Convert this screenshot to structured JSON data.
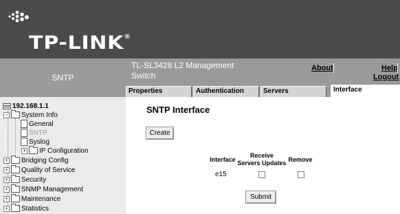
{
  "brand": {
    "logo_text": "TP-LINK",
    "registered": "®"
  },
  "section": {
    "title": "SNTP"
  },
  "device": {
    "title": "TL-SL3428 L2 Management Switch"
  },
  "header_links": {
    "about": "About",
    "help": "Help",
    "logout": "Logout"
  },
  "tabs": [
    {
      "label": "Properties",
      "active": false
    },
    {
      "label": "Authentication",
      "active": false
    },
    {
      "label": "Servers",
      "active": false
    },
    {
      "label": "Interface",
      "active": true
    }
  ],
  "tree": {
    "root": "192.168.1.1",
    "items": [
      {
        "label": "System Info",
        "expanded": true
      },
      {
        "label": "General"
      },
      {
        "label": "SNTP",
        "selected": true
      },
      {
        "label": "Syslog"
      },
      {
        "label": "IP Configuration"
      },
      {
        "label": "Bridging Config"
      },
      {
        "label": "Quality of Service"
      },
      {
        "label": "Security"
      },
      {
        "label": "SNMP Management"
      },
      {
        "label": "Maintenance"
      },
      {
        "label": "Statistics"
      }
    ]
  },
  "main": {
    "title": "SNTP Interface",
    "create_label": "Create",
    "submit_label": "Submit",
    "table": {
      "headers": [
        "Interface",
        "Receive Servers Updates",
        "Remove"
      ],
      "header_receive_line1": "Receive",
      "header_receive_line2": "Servers Updates",
      "rows": [
        {
          "interface": "e15",
          "receive_updates": false,
          "remove": false
        }
      ]
    }
  },
  "colors": {
    "header_bg": "#4a4a4a",
    "bar_bg": "#9a9a9a",
    "tree_bg": "#ebebeb",
    "tab_bg": "#d4d4d4"
  }
}
